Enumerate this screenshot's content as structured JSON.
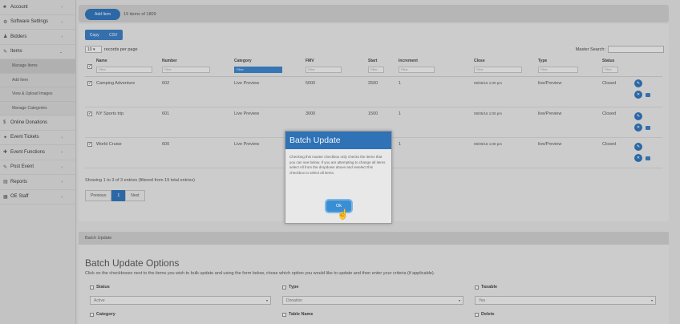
{
  "sidebar": {
    "items": [
      {
        "label": "Account",
        "icon": "account-icon"
      },
      {
        "label": "Software Settings",
        "icon": "settings-icon"
      },
      {
        "label": "Bidders",
        "icon": "bidders-icon"
      },
      {
        "label": "Items",
        "icon": "items-icon"
      }
    ],
    "sub_items": [
      "Manage Items",
      "Add Item",
      "View & Upload Images",
      "Manage Categories"
    ],
    "lower_items": [
      {
        "label": "Online Donations",
        "icon": "donation-icon"
      },
      {
        "label": "Event Tickets",
        "icon": "ticket-icon"
      },
      {
        "label": "Event Functions",
        "icon": "functions-icon"
      },
      {
        "label": "Post Event",
        "icon": "post-event-icon"
      },
      {
        "label": "Reports",
        "icon": "reports-icon"
      },
      {
        "label": "OE Staff",
        "icon": "staff-icon"
      }
    ]
  },
  "topbar": {
    "add_label": "Add Item",
    "count_text": "19 items of 1809"
  },
  "toolbar": {
    "copy_label": "Copy",
    "csv_label": "CSV",
    "rpp_value": "10",
    "rpp_text": "records per page",
    "master_search_label": "Master Search:"
  },
  "table": {
    "headers": [
      "Name",
      "Number",
      "Category",
      "FMV",
      "Start",
      "Increment",
      "Close",
      "Type",
      "Status"
    ],
    "filter_placeholder": "Filter",
    "rows": [
      {
        "name": "Camping Adventure",
        "number": "602",
        "category": "Live Preview",
        "fmv": "5000",
        "start": "2500",
        "increment": "1",
        "close": "08/05/16 1:00 pm",
        "type": "live/Preview",
        "status": "Closed"
      },
      {
        "name": "NY Sports trip",
        "number": "601",
        "category": "Live Preview",
        "fmv": "3000",
        "start": "1500",
        "increment": "1",
        "close": "08/05/16 1:00 pm",
        "type": "live/Preview",
        "status": "Closed"
      },
      {
        "name": "World Cruise",
        "number": "600",
        "category": "Live Preview",
        "fmv": "",
        "start": "",
        "increment": "1",
        "close": "08/09/16 1:00 pm",
        "type": "live/Preview",
        "status": "Closed"
      }
    ]
  },
  "footer": {
    "showing": "Showing 1 to 3 of 3 entries (filtered from 19 total entries)",
    "prev": "Previous",
    "page": "1",
    "next": "Next"
  },
  "batch": {
    "bar_label": "Batch Update",
    "title": "Batch Update Options",
    "desc": "Click on the checkboxes next to the items you wish to bulk update and using the form below, chose which option you would like to update and then enter your criteria (if applicable).",
    "options": [
      {
        "label": "Status",
        "value": "Active"
      },
      {
        "label": "Type",
        "value": "Donation"
      },
      {
        "label": "Taxable",
        "value": "Yes"
      },
      {
        "label": "Category",
        "value": ""
      },
      {
        "label": "Table Name",
        "value": ""
      },
      {
        "label": "Delete",
        "value": ""
      }
    ]
  },
  "modal": {
    "title": "Batch Update",
    "body": "Checking this master checkbox only checks the items that you can see below. If you are attempting to change all items select All from the dropdown above and reselect this checkbox to select all items.",
    "ok_label": "Ok"
  },
  "colors": {
    "accent": "#2f6fb0",
    "modal_header": "#2f72b6"
  }
}
